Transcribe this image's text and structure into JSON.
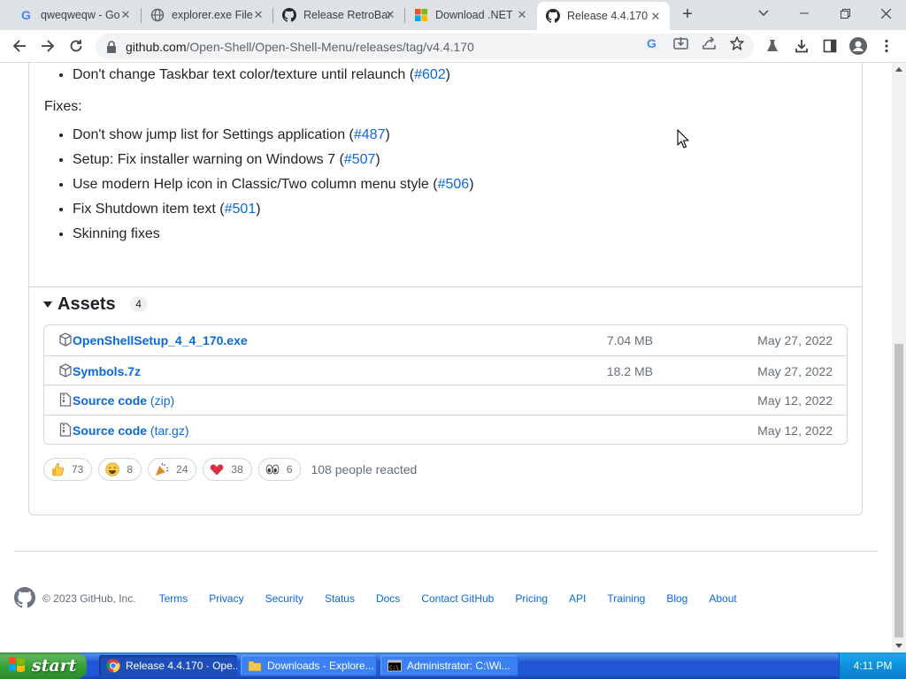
{
  "browser": {
    "tabs": [
      {
        "title": "qweqweqw - Go",
        "icon": "google-g-icon"
      },
      {
        "title": "explorer.exe File",
        "icon": "globe-icon"
      },
      {
        "title": "Release RetroBar",
        "icon": "github-icon"
      },
      {
        "title": "Download .NET",
        "icon": "microsoft-icon"
      },
      {
        "title": "Release 4.4.170",
        "icon": "github-icon",
        "active": true
      }
    ],
    "url_host": "github.com",
    "url_path": "/Open-Shell/Open-Shell-Menu/releases/tag/v4.4.170"
  },
  "notes": {
    "top_item": {
      "text": "Don't change Taskbar text color/texture until relaunch (",
      "link": "#602",
      "close": ")"
    },
    "fixes_label": "Fixes:",
    "fixes": [
      {
        "text": "Don't show jump list for Settings application (",
        "link": "#487",
        "close": ")"
      },
      {
        "text": "Setup: Fix installer warning on Windows 7 (",
        "link": "#507",
        "close": ")"
      },
      {
        "text": "Use modern Help icon in Classic/Two column menu style (",
        "link": "#506",
        "close": ")"
      },
      {
        "text": "Fix Shutdown item text (",
        "link": "#501",
        "close": ")"
      },
      {
        "text": "Skinning fixes",
        "link": "",
        "close": ""
      }
    ]
  },
  "assets": {
    "title": "Assets",
    "count": "4",
    "items": [
      {
        "name": "OpenShellSetup_4_4_170.exe",
        "ext": "",
        "size": "7.04 MB",
        "date": "May 27, 2022",
        "icon": "package-icon"
      },
      {
        "name": "Symbols.7z",
        "ext": "",
        "size": "18.2 MB",
        "date": "May 27, 2022",
        "icon": "package-icon"
      },
      {
        "name": "Source code",
        "ext": " (zip)",
        "size": "",
        "date": "May 12, 2022",
        "icon": "file-zip-icon"
      },
      {
        "name": "Source code",
        "ext": " (tar.gz)",
        "size": "",
        "date": "May 12, 2022",
        "icon": "file-zip-icon"
      }
    ]
  },
  "reactions": {
    "items": [
      {
        "emoji": "thumbs-up-icon",
        "count": "73"
      },
      {
        "emoji": "laugh-icon",
        "count": "8"
      },
      {
        "emoji": "tada-icon",
        "count": "24"
      },
      {
        "emoji": "heart-icon",
        "count": "38"
      },
      {
        "emoji": "eyes-icon",
        "count": "6"
      }
    ],
    "summary": "108 people reacted"
  },
  "footer": {
    "copyright": "© 2023 GitHub, Inc.",
    "links": [
      "Terms",
      "Privacy",
      "Security",
      "Status",
      "Docs",
      "Contact GitHub",
      "Pricing",
      "API",
      "Training",
      "Blog",
      "About"
    ]
  },
  "taskbar": {
    "start_label": "start",
    "tasks": [
      {
        "label": "Release 4.4.170 · Ope...",
        "active": true,
        "icon": "chrome-icon"
      },
      {
        "label": "Downloads - Explore...",
        "active": false,
        "icon": "folder-icon"
      },
      {
        "label": "Administrator: C:\\Wi...",
        "active": false,
        "icon": "cmd-icon"
      }
    ],
    "clock": "4:11 PM"
  },
  "colors": {
    "link": "#0969da",
    "muted": "#656d76",
    "border": "#d0d7de",
    "xp_blue": "#2157d7",
    "xp_green": "#36a136"
  }
}
